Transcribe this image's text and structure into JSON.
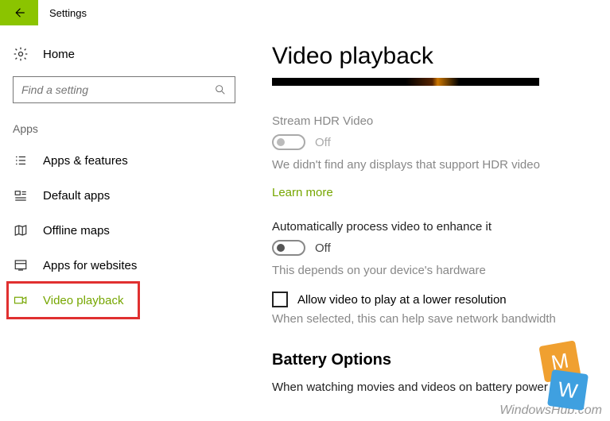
{
  "app_title": "Settings",
  "sidebar": {
    "home": "Home",
    "search_placeholder": "Find a setting",
    "category": "Apps",
    "items": [
      {
        "label": "Apps & features"
      },
      {
        "label": "Default apps"
      },
      {
        "label": "Offline maps"
      },
      {
        "label": "Apps for websites"
      },
      {
        "label": "Video playback"
      }
    ]
  },
  "main": {
    "title": "Video playback",
    "hdr": {
      "label": "Stream HDR Video",
      "state": "Off",
      "helper": "We didn't find any displays that support HDR video",
      "learn_more": "Learn more"
    },
    "auto": {
      "label": "Automatically process video to enhance it",
      "state": "Off",
      "helper": "This depends on your device's hardware"
    },
    "lowres": {
      "label": "Allow video to play at a lower resolution",
      "helper": "When selected, this can help save network bandwidth"
    },
    "battery": {
      "heading": "Battery Options",
      "text": "When watching movies and videos on battery power"
    }
  },
  "watermark": "WindowsHub.com"
}
